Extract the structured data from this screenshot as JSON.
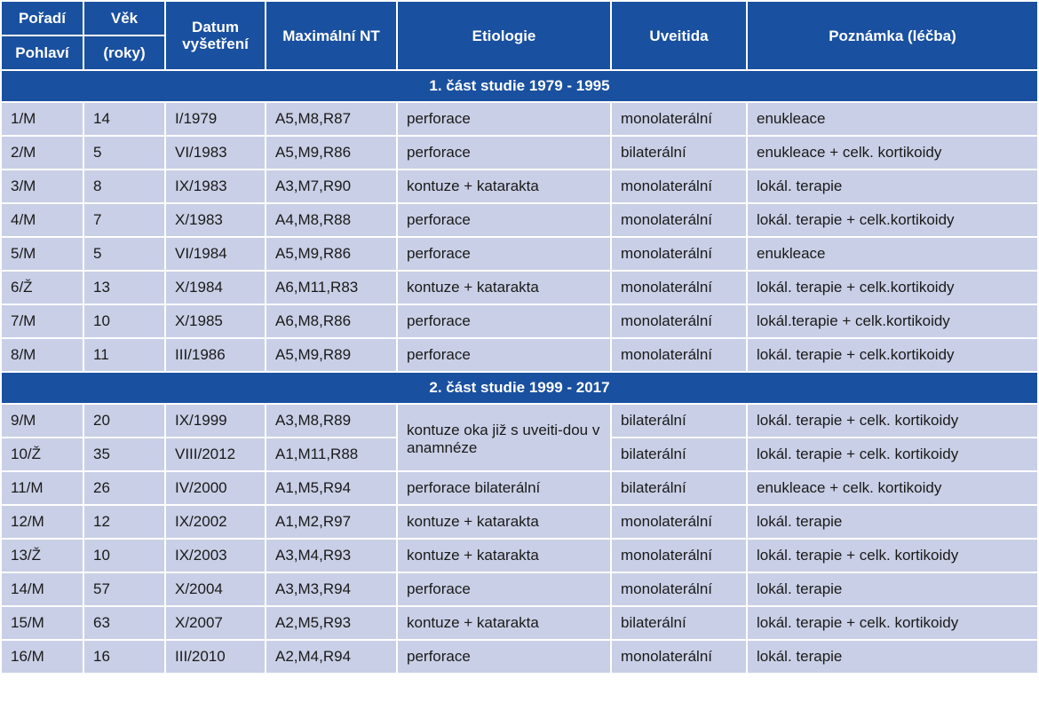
{
  "headers": {
    "order_label": "Pořadí",
    "sex_label": "Pohlaví",
    "age_label": "Věk",
    "age_unit": "(roky)",
    "date_label": "Datum vyšetření",
    "max_nt_label": "Maximální NT",
    "etiology_label": "Etiologie",
    "uveitis_label": "Uveitida",
    "note_label": "Poznámka (léčba)"
  },
  "section1": {
    "title": "1. část studie 1979 - 1995"
  },
  "section2": {
    "title": "2. část studie 1999 - 2017"
  },
  "rows1": [
    {
      "id": "1/M",
      "age": "14",
      "date": "I/1979",
      "nt": "A5,M8,R87",
      "etiology": "perforace",
      "uveitis": "monolaterální",
      "note": "enukleace"
    },
    {
      "id": "2/M",
      "age": "5",
      "date": "VI/1983",
      "nt": "A5,M9,R86",
      "etiology": "perforace",
      "uveitis": "bilaterální",
      "note": "enukleace + celk. kortikoidy"
    },
    {
      "id": "3/M",
      "age": "8",
      "date": "IX/1983",
      "nt": "A3,M7,R90",
      "etiology": "kontuze + katarakta",
      "uveitis": "monolaterální",
      "note": "lokál. terapie"
    },
    {
      "id": "4/M",
      "age": "7",
      "date": "X/1983",
      "nt": "A4,M8,R88",
      "etiology": "perforace",
      "uveitis": "monolaterální",
      "note": "lokál. terapie + celk.kortikoidy"
    },
    {
      "id": "5/M",
      "age": "5",
      "date": "VI/1984",
      "nt": "A5,M9,R86",
      "etiology": "perforace",
      "uveitis": "monolaterální",
      "note": "enukleace"
    },
    {
      "id": "6/Ž",
      "age": "13",
      "date": "X/1984",
      "nt": "A6,M11,R83",
      "etiology": "kontuze + katarakta",
      "uveitis": "monolaterální",
      "note": "lokál. terapie + celk.kortikoidy"
    },
    {
      "id": "7/M",
      "age": "10",
      "date": "X/1985",
      "nt": "A6,M8,R86",
      "etiology": "perforace",
      "uveitis": "monolaterální",
      "note": "lokál.terapie + celk.kortikoidy"
    },
    {
      "id": "8/M",
      "age": "11",
      "date": "III/1986",
      "nt": "A5,M9,R89",
      "etiology": "perforace",
      "uveitis": "monolaterální",
      "note": "lokál. terapie + celk.kortikoidy"
    }
  ],
  "rows2": [
    {
      "id": "9/M",
      "age": "20",
      "date": "IX/1999",
      "nt": "A3,M8,R89",
      "etiology": "kontuze oka již s uveiti-dou v anamnéze",
      "uveitis": "bilaterální",
      "note": "lokál. terapie + celk. kortikoidy"
    },
    {
      "id": "10/Ž",
      "age": "35",
      "date": "VIII/2012",
      "nt": "A1,M11,R88",
      "etiology": "",
      "uveitis": "bilaterální",
      "note": "lokál. terapie + celk. kortikoidy"
    },
    {
      "id": "11/M",
      "age": "26",
      "date": "IV/2000",
      "nt": "A1,M5,R94",
      "etiology": "perforace bilaterální",
      "uveitis": "bilaterální",
      "note": "enukleace + celk. kortikoidy"
    },
    {
      "id": "12/M",
      "age": "12",
      "date": "IX/2002",
      "nt": "A1,M2,R97",
      "etiology": "kontuze + katarakta",
      "uveitis": "monolaterální",
      "note": "lokál. terapie"
    },
    {
      "id": "13/Ž",
      "age": "10",
      "date": "IX/2003",
      "nt": "A3,M4,R93",
      "etiology": "kontuze + katarakta",
      "uveitis": "monolaterální",
      "note": "lokál. terapie + celk. kortikoidy"
    },
    {
      "id": "14/M",
      "age": "57",
      "date": "X/2004",
      "nt": "A3,M3,R94",
      "etiology": "perforace",
      "uveitis": "monolaterální",
      "note": "lokál. terapie"
    },
    {
      "id": "15/M",
      "age": "63",
      "date": "X/2007",
      "nt": "A2,M5,R93",
      "etiology": "kontuze + katarakta",
      "uveitis": "bilaterální",
      "note": "lokál. terapie + celk. kortikoidy"
    },
    {
      "id": "16/M",
      "age": "16",
      "date": "III/2010",
      "nt": "A2,M4,R94",
      "etiology": "perforace",
      "uveitis": "monolaterální",
      "note": "lokál. terapie"
    }
  ]
}
